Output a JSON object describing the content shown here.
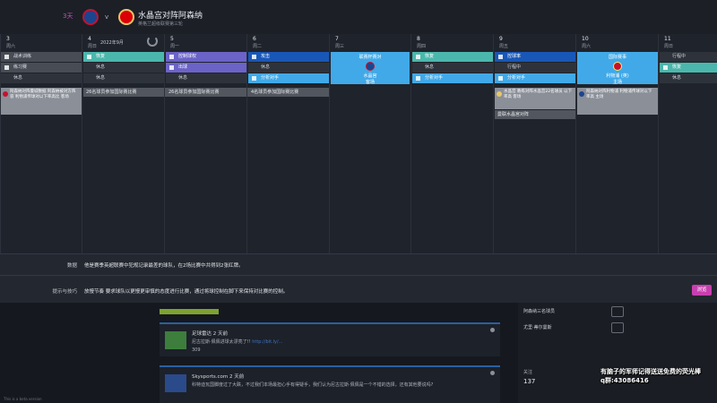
{
  "header": {
    "days_badge": "3天",
    "vs": "v",
    "match_title": "水晶宫对阵阿森纳",
    "match_sub": "英格兰超级联赛第三轮"
  },
  "calendar": {
    "month_label": "2022年9月",
    "days": [
      {
        "num": "3",
        "week": "周六"
      },
      {
        "num": "4",
        "week": "周日"
      },
      {
        "num": "5",
        "week": "周一"
      },
      {
        "num": "6",
        "week": "周二"
      },
      {
        "num": "7",
        "week": "周三"
      },
      {
        "num": "8",
        "week": "周四"
      },
      {
        "num": "9",
        "week": "周五"
      },
      {
        "num": "10",
        "week": "周六"
      },
      {
        "num": "11",
        "week": "周日"
      }
    ],
    "slots": {
      "d3": [
        "战术训练",
        "练习赛",
        "休息"
      ],
      "d4": [
        "恢复",
        "休息",
        "休息"
      ],
      "d5": [
        "控制球权",
        "出球",
        "休息"
      ],
      "d6": [
        "攻击",
        "休息",
        "分析对手"
      ],
      "d8": [
        "恢复",
        "休息",
        "分析对手"
      ],
      "d9": [
        "控球率",
        "行程中",
        "分析对手"
      ],
      "d11": [
        "行程中",
        "恢复",
        "休息"
      ]
    },
    "match_d7": {
      "top": "联赛杯赛对",
      "middle": "水晶宫",
      "bottom": "客场"
    },
    "match_d10": {
      "top": "国际赛事",
      "middle": "利物浦 (英)",
      "bottom": "主场"
    },
    "notes": {
      "d3_card": "阿森纳对阵曼城数据 阿森纳被对方阵容 利物浦传球对以下率高比 客场",
      "d4_bar": "26名球员参加国际赛比赛",
      "d5_bar": "26名球员参加国际赛比赛",
      "d6_bar": "4名球员参加国际赛比赛",
      "d9_card": "水晶宫 教练对阵水晶宫22名球员 以下率高 客场",
      "d9_bar": "曼联水晶宫对阵",
      "d10_card": "阿森纳对阵利物浦 利物浦传球对以下率高 主场"
    }
  },
  "info": {
    "data_label": "数据",
    "data_text": "他是赛季英超联赛中犯规记录最差的球队，在2场比赛中共得到2张红牌。",
    "tips_label": "提示与技巧",
    "tips_text": "放慢节奏 要求球队以更慢更审慎的态度进行比赛，通过将球控制在脚下来保持对比赛的控制。",
    "view_button": "浏览"
  },
  "feed": [
    {
      "source": "足球雷达 2 天前",
      "text": "尼古拉斯·佩佩进球太漂亮了!! ",
      "link": "http://bit.ly/...",
      "likes": "309"
    },
    {
      "source": "Skysports.com 2 天前",
      "text": "科特迪瓦国脚度过了大跌，不过我们本场最担心手有得疑手，我们认为尼古拉斯·佩佩是一个不错的选择，还有其他要说吗?",
      "link": "",
      "likes": ""
    }
  ],
  "side": {
    "rows": [
      "阿森纳三名球员",
      "尤里·蒂尔曼斯"
    ],
    "followers_label": "关注",
    "followers": "137"
  },
  "overlay": {
    "line1": "有脑子的军师记得送送免费的荧光棒",
    "line2": "q群:43086416"
  },
  "footer_note": "This is a beta version"
}
